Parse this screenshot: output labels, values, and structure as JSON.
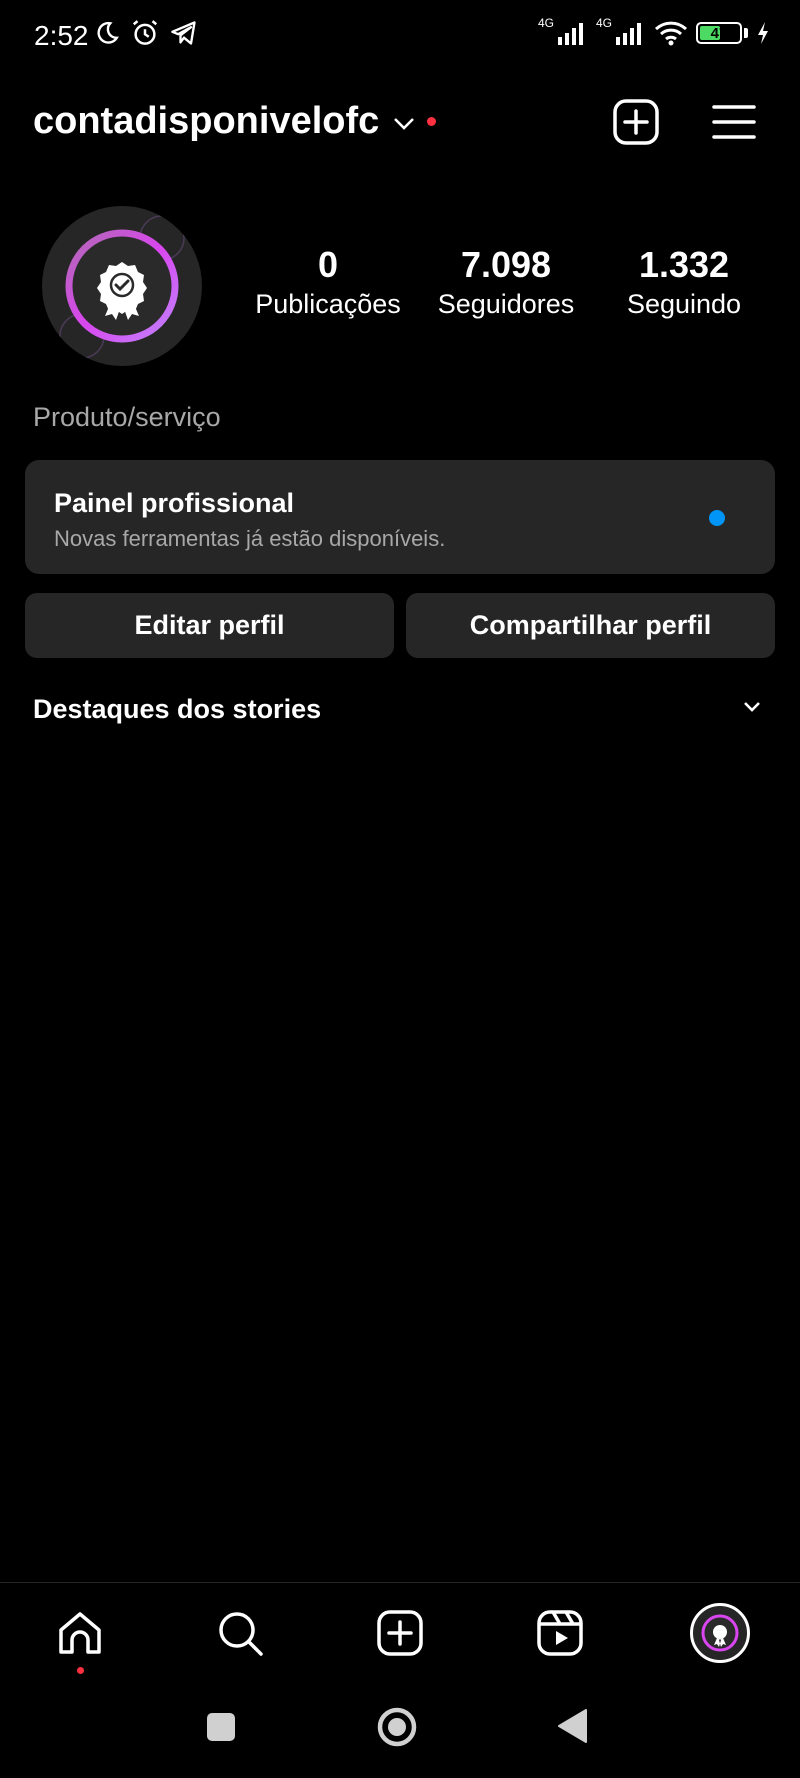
{
  "status_bar": {
    "time": "2:52",
    "network_1": "4G",
    "network_2": "4G",
    "battery": "47",
    "icons": [
      "moon-icon",
      "alarm-icon",
      "telegram-icon",
      "signal-icon",
      "wifi-icon",
      "battery-icon",
      "charging-icon"
    ]
  },
  "header": {
    "username": "contadisponivelofc",
    "notification_dot_color": "#ff3040"
  },
  "profile": {
    "stats": [
      {
        "value": "0",
        "label": "Publicações"
      },
      {
        "value": "7.098",
        "label": "Seguidores"
      },
      {
        "value": "1.332",
        "label": "Seguindo"
      }
    ],
    "category": "Produto/serviço"
  },
  "professional_panel": {
    "title": "Painel profissional",
    "subtitle": "Novas ferramentas já estão disponíveis.",
    "dot_color": "#0095f6"
  },
  "actions": {
    "edit_label": "Editar perfil",
    "share_label": "Compartilhar perfil"
  },
  "highlights": {
    "label": "Destaques dos stories"
  },
  "bottom_nav": {
    "items": [
      "home-icon",
      "search-icon",
      "create-icon",
      "reels-icon",
      "profile-avatar"
    ]
  },
  "colors": {
    "background": "#000000",
    "surface": "#262626",
    "secondary_text": "#a8a8a8",
    "accent_blue": "#0095f6",
    "accent_red": "#ff3040"
  }
}
